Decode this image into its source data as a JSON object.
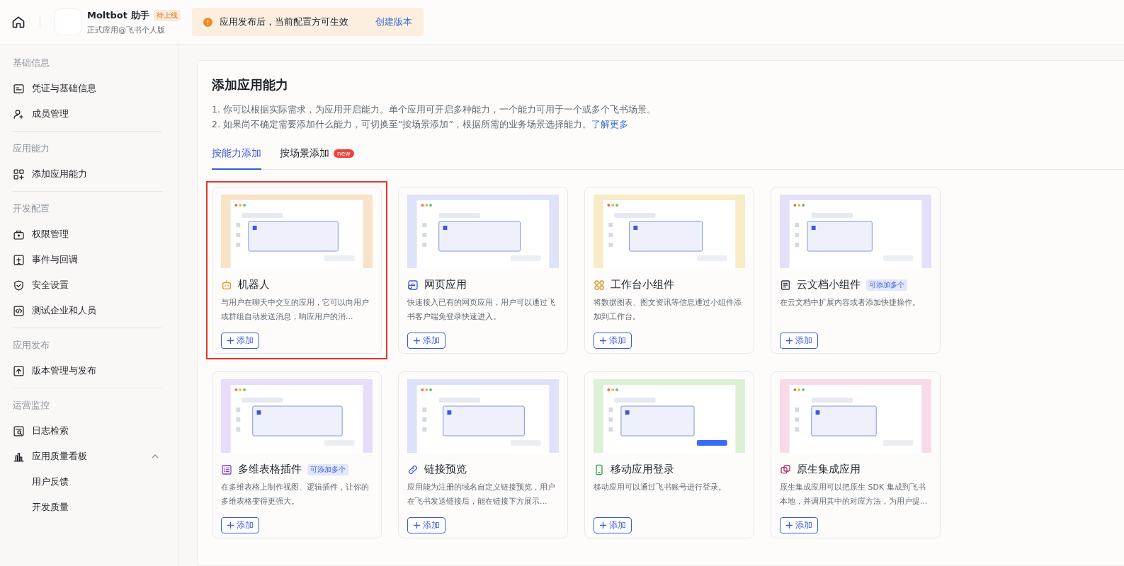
{
  "header": {
    "app_name": "Moltbot 助手",
    "status_badge": "待上线",
    "app_subtitle": "正式应用@飞书个人版",
    "notice": "应用发布后，当前配置方可生效",
    "notice_link": "创建版本"
  },
  "sidebar": {
    "sections": [
      {
        "title": "基础信息",
        "items": [
          {
            "label": "凭证与基础信息"
          },
          {
            "label": "成员管理"
          }
        ]
      },
      {
        "title": "应用能力",
        "items": [
          {
            "label": "添加应用能力"
          }
        ]
      },
      {
        "title": "开发配置",
        "items": [
          {
            "label": "权限管理"
          },
          {
            "label": "事件与回调"
          },
          {
            "label": "安全设置"
          },
          {
            "label": "测试企业和人员"
          }
        ]
      },
      {
        "title": "应用发布",
        "items": [
          {
            "label": "版本管理与发布"
          }
        ]
      },
      {
        "title": "运营监控",
        "items": [
          {
            "label": "日志检索"
          },
          {
            "label": "应用质量看板",
            "expanded": true,
            "children": [
              {
                "label": "用户反馈"
              },
              {
                "label": "开发质量"
              }
            ]
          }
        ]
      }
    ]
  },
  "main": {
    "title": "添加应用能力",
    "notes": [
      "1. 你可以根据实际需求，为应用开启能力。单个应用可开启多种能力，一个能力可用于一个或多个飞书场景。",
      "2. 如果尚不确定需要添加什么能力，可切换至“按场景添加”，根据所需的业务场景选择能力。"
    ],
    "learn_more": "了解更多",
    "tabs": [
      {
        "label": "按能力添加",
        "selected": true
      },
      {
        "label": "按场景添加",
        "selected": false,
        "badge": "new"
      }
    ],
    "cards": [
      {
        "title": "机器人",
        "description": "与用户在聊天中交互的应用，它可以向用户或群组自动发送消息，响应用户的消...",
        "button": "添加",
        "color": "#f9e3c8",
        "highlighted": true
      },
      {
        "title": "网页应用",
        "description": "快速接入已有的网页应用，用户可以通过飞书客户端免登录快速进入。",
        "button": "添加",
        "color": "#dfe3fa",
        "highlighted": false
      },
      {
        "title": "工作台小组件",
        "description": "将数据图表、图文资讯等信息通过小组件添加到工作台。",
        "button": "添加",
        "color": "#f6ecc6",
        "highlighted": false
      },
      {
        "title": "云文档小组件",
        "badge": "可添加多个",
        "description": "在云文档中扩展内容或者添加快捷操作。",
        "button": "添加",
        "color": "#e4e0fa",
        "highlighted": false
      },
      {
        "title": "多维表格插件",
        "badge": "可添加多个",
        "description": "在多维表格上制作视图、逻辑插件，让你的多维表格变得更强大。",
        "button": "添加",
        "color": "#e8dcfa",
        "highlighted": false
      },
      {
        "title": "链接预览",
        "description": "应用能为注册的域名自定义链接预览，用户在飞书发送链接后，能在链接下方展示...",
        "button": "添加",
        "color": "#dde2fa",
        "highlighted": false
      },
      {
        "title": "移动应用登录",
        "description": "移动应用可以通过飞书账号进行登录。",
        "button": "添加",
        "color": "#dcf0d6",
        "highlighted": false
      },
      {
        "title": "原生集成应用",
        "description": "原生集成应用可以把原生 SDK 集成到飞书本地，并调用其中的对应方法，为用户提...",
        "button": "添加",
        "color": "#f8dbe8",
        "highlighted": false
      }
    ]
  }
}
